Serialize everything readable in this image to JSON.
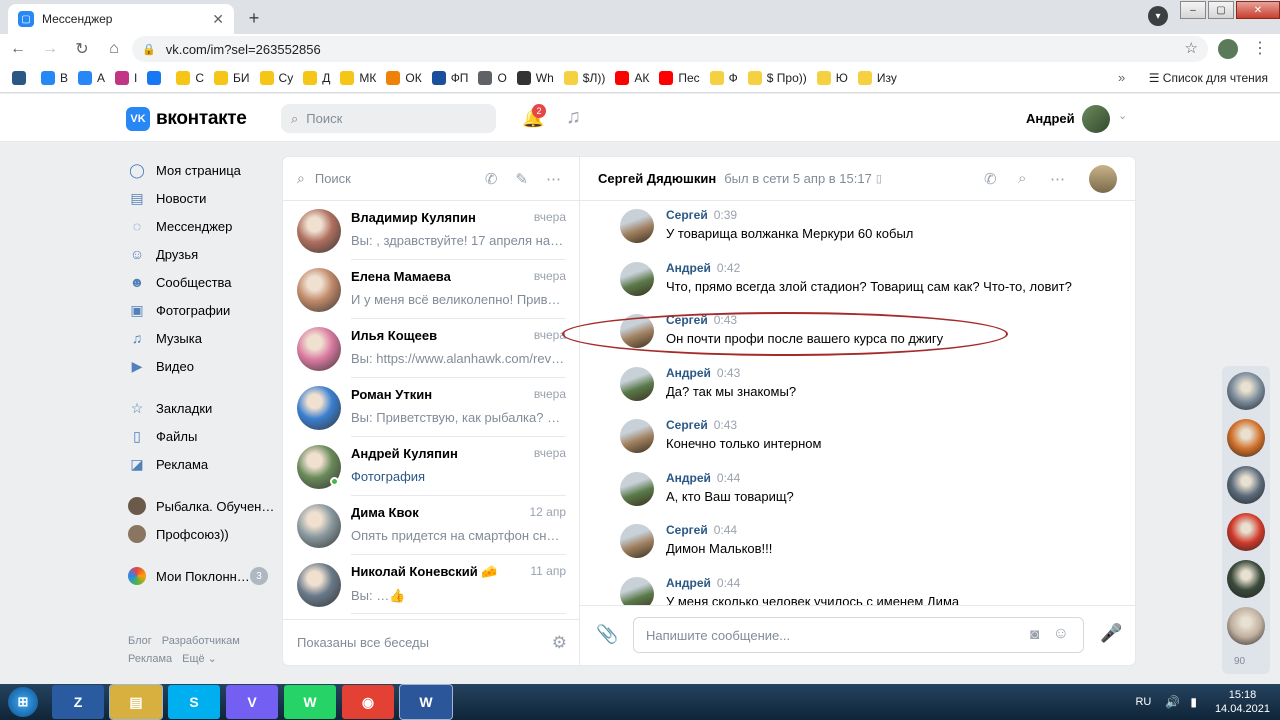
{
  "browser": {
    "tab_title": "Мессенджер",
    "tab_close": "✕",
    "new_tab": "+",
    "url": "vk.com/im?sel=263552856",
    "bookmarks": [
      {
        "label": "",
        "color": "#2a5885"
      },
      {
        "label": "В",
        "color": "#2787f5"
      },
      {
        "label": "А",
        "color": "#2787f5"
      },
      {
        "label": "I",
        "color": "#c13584"
      },
      {
        "label": "",
        "color": "#1877f2"
      },
      {
        "label": "С",
        "color": "#f5c518"
      },
      {
        "label": "БИ",
        "color": "#f5c518"
      },
      {
        "label": "Су",
        "color": "#f5c518"
      },
      {
        "label": "Д",
        "color": "#f5c518"
      },
      {
        "label": "МК",
        "color": "#f5c518"
      },
      {
        "label": "ОК",
        "color": "#ee8208"
      },
      {
        "label": "ФП",
        "color": "#1a4f9c"
      },
      {
        "label": "О",
        "color": "#5f6368"
      },
      {
        "label": "Wh",
        "color": "#333"
      },
      {
        "label": "$Л))",
        "color": "#f5d142"
      },
      {
        "label": "АК",
        "color": "#ff0000"
      },
      {
        "label": "Пес",
        "color": "#ff0000"
      },
      {
        "label": "Ф",
        "color": "#f5d142"
      },
      {
        "label": "$ Про))",
        "color": "#f5d142"
      },
      {
        "label": "Ю",
        "color": "#f5d142"
      },
      {
        "label": "Изу",
        "color": "#f5d142"
      }
    ],
    "bookmarks_more": "»",
    "reading_list": "Список для чтения"
  },
  "vk": {
    "logo_text": "вконтакте",
    "search_placeholder": "Поиск",
    "notif_count": "2",
    "user_name": "Андрей",
    "nav": [
      {
        "label": "Моя страница",
        "icon": "◯"
      },
      {
        "label": "Новости",
        "icon": "▤"
      },
      {
        "label": "Мессенджер",
        "icon": "◌"
      },
      {
        "label": "Друзья",
        "icon": "☺"
      },
      {
        "label": "Сообщества",
        "icon": "☻"
      },
      {
        "label": "Фотографии",
        "icon": "▣"
      },
      {
        "label": "Музыка",
        "icon": "♫"
      },
      {
        "label": "Видео",
        "icon": "▶"
      }
    ],
    "nav2": [
      {
        "label": "Закладки",
        "icon": "☆"
      },
      {
        "label": "Файлы",
        "icon": "▯"
      },
      {
        "label": "Реклама",
        "icon": "◪"
      }
    ],
    "groups": [
      {
        "label": "Рыбалка. Обучен…",
        "color": "#6b5a4a"
      },
      {
        "label": "Профсоюз))",
        "color": "#8a7560"
      }
    ],
    "fans": {
      "label": "Мои Поклонн…",
      "count": "3"
    },
    "footer": [
      "Блог",
      "Разработчикам",
      "Реклама",
      "Ещё ⌄"
    ]
  },
  "convlist": {
    "search_placeholder": "Поиск",
    "footer": "Показаны все беседы",
    "items": [
      {
        "name": "Владимир Куляпин",
        "date": "вчера",
        "preview": "Вы: , здравствуйте! 17 апреля на выс…",
        "color": "#b07060",
        "blue": false,
        "online": false
      },
      {
        "name": "Елена Мамаева",
        "date": "вчера",
        "preview": "И у меня всё великолепно! Привет, А…",
        "color": "#c08a6a",
        "blue": false,
        "online": false
      },
      {
        "name": "Илья Кощеев",
        "date": "вчера",
        "preview": "Вы: https://www.alanhawk.com/review…",
        "color": "#d97aa0",
        "blue": false,
        "online": false
      },
      {
        "name": "Роман Уткин",
        "date": "вчера",
        "preview": "Вы: Приветствую, как рыбалка? Суда…",
        "color": "#3a7fd0",
        "blue": false,
        "online": false
      },
      {
        "name": "Андрей Куляпин",
        "date": "вчера",
        "preview": "Фотография",
        "color": "#6a8a5a",
        "blue": true,
        "online": true
      },
      {
        "name": "Дима Квок",
        "date": "12 апр",
        "preview": "Опять придется на смартфон снимат…",
        "color": "#8a9aa0",
        "blue": false,
        "online": false
      },
      {
        "name": "Николай Коневский 🧀",
        "date": "11 апр",
        "preview": "Вы: …👍",
        "color": "#6a7a8a",
        "blue": false,
        "online": false
      }
    ]
  },
  "chat": {
    "contact_name": "Сергей Дядюшкин",
    "status": "был в сети 5 апр в 15:17",
    "input_placeholder": "Напишите сообщение...",
    "messages": [
      {
        "author": "Сергей",
        "time": "0:39",
        "text": "У товарища волжанка Меркури 60 кобыл",
        "color": "#a08060"
      },
      {
        "author": "Андрей",
        "time": "0:42",
        "text": "Что, прямо всегда злой стадион? Товарищ сам как? Что-то, ловит?",
        "color": "#5a7a4a"
      },
      {
        "author": "Сергей",
        "time": "0:43",
        "text": "Он почти профи после вашего курса по джигу",
        "color": "#a08060"
      },
      {
        "author": "Андрей",
        "time": "0:43",
        "text": "Да? так мы знакомы?",
        "color": "#5a7a4a"
      },
      {
        "author": "Сергей",
        "time": "0:43",
        "text": "Конечно только интерном",
        "color": "#a08060"
      },
      {
        "author": "Андрей",
        "time": "0:44",
        "text": "А, кто Ваш товарищ?",
        "color": "#5a7a4a"
      },
      {
        "author": "Сергей",
        "time": "0:44",
        "text": "Димон Мальков!!!",
        "color": "#a08060"
      },
      {
        "author": "Андрей",
        "time": "0:44",
        "text": "У меня сколько человек училось с именем Дима",
        "color": "#5a7a4a"
      }
    ]
  },
  "rightbar": {
    "avatars": [
      "#7a8a9a",
      "#d0702a",
      "#5a6a7a",
      "#d03a2a",
      "#3a4a3a",
      "#c0b0a0"
    ],
    "count": "90"
  },
  "taskbar": {
    "lang": "RU",
    "time": "15:18",
    "date": "14.04.2021",
    "apps": [
      {
        "label": "Z",
        "color": "#2a5aa0"
      },
      {
        "label": "▤",
        "color": "#d8b040"
      },
      {
        "label": "S",
        "color": "#00aff0"
      },
      {
        "label": "V",
        "color": "#7360f2"
      },
      {
        "label": "W",
        "color": "#25d366"
      },
      {
        "label": "◉",
        "color": "#e34133"
      },
      {
        "label": "W",
        "color": "#2b579a"
      }
    ]
  }
}
